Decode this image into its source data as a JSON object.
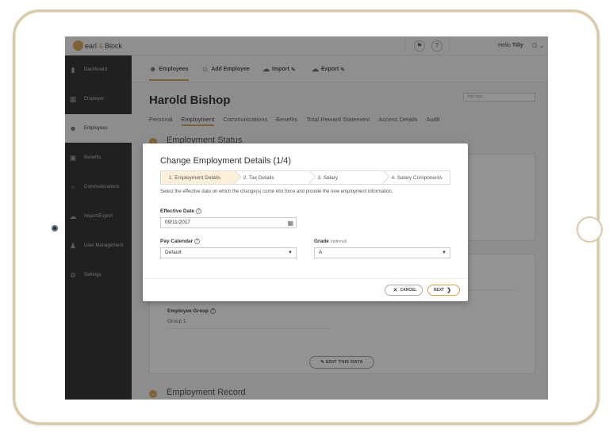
{
  "topbar": {
    "logo_word1": "earl",
    "logo_amp": "&",
    "logo_word2": "Block",
    "notification_icon": "bell-icon",
    "help_label": "?",
    "greeting": "Hello",
    "user_name": "Tilly"
  },
  "sidebar": {
    "items": [
      {
        "label": "Dashboard",
        "icon": "bar-chart-icon"
      },
      {
        "label": "Employer",
        "icon": "building-icon"
      },
      {
        "label": "Employees",
        "icon": "people-icon"
      },
      {
        "label": "Benefits",
        "icon": "gift-icon"
      },
      {
        "label": "Communications",
        "icon": "chat-icon"
      },
      {
        "label": "Import/Export",
        "icon": "cloud-icon"
      },
      {
        "label": "User Management",
        "icon": "user-gear-icon"
      },
      {
        "label": "Settings",
        "icon": "gear-icon"
      }
    ],
    "active": "Employees"
  },
  "subnav": {
    "items": [
      {
        "label": "Employees",
        "icon": "people-icon"
      },
      {
        "label": "Add Employee",
        "icon": "add-user-icon"
      },
      {
        "label": "Import",
        "icon": "import-icon"
      },
      {
        "label": "Export",
        "icon": "export-icon"
      }
    ]
  },
  "employee": {
    "name": "Harold Bishop",
    "tags_placeholder": "Add tags..."
  },
  "tabs": [
    "Personal",
    "Employment",
    "Communications",
    "Benefits",
    "Total Reward Statement",
    "Access Details",
    "Audit"
  ],
  "sections": {
    "status_title": "Employment Status",
    "record_title": "Employment Record",
    "employee_group_label": "Employee Group",
    "employee_group_value": "Group 1",
    "edit_button": "EDIT THIS DATA"
  },
  "modal": {
    "title": "Change Employment Details (1/4)",
    "steps": [
      "1. Employment Details",
      "2. Tax Details",
      "3. Salary",
      "4. Salary Components"
    ],
    "description": "Select the effective date on which the change(s) come into force and provide the new employment information.",
    "effective_date_label": "Effective Date",
    "effective_date_value": "09/11/2017",
    "pay_calendar_label": "Pay Calendar",
    "pay_calendar_value": "Default",
    "grade_label": "Grade",
    "grade_optional": "(optional)",
    "grade_value": "A",
    "cancel_label": "CANCEL",
    "next_label": "NEXT"
  },
  "colors": {
    "accent": "#d9a14a",
    "sidebar_bg": "#242424"
  }
}
